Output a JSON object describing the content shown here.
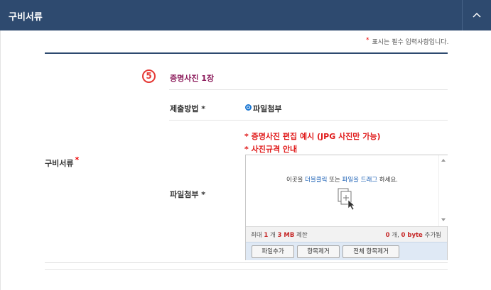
{
  "header": {
    "title": "구비서류"
  },
  "required_note": {
    "star": "*",
    "text": "표시는 필수 입력사항입니다."
  },
  "section": {
    "label": "구비서류",
    "star": "*"
  },
  "photo": {
    "number": "5",
    "title": "증명사진 1장"
  },
  "submit_method": {
    "label": "제출방법 *",
    "option": "파일첨부"
  },
  "links": {
    "example": "* 증명사진 편집 예시 (JPG 사진만 가능)",
    "guide": "* 사진규격 안내"
  },
  "attach": {
    "label": "파일첨부 *"
  },
  "uploader": {
    "drop_text_1": "이곳을 ",
    "drop_text_2": "더블클릭",
    "drop_text_3": " 또는 ",
    "drop_text_4": "파일을 드래그",
    "drop_text_5": " 하세요.",
    "limit_prefix": "최대 ",
    "limit_count": "1",
    "limit_mid": " 개 ",
    "limit_size": "3 MB",
    "limit_suffix": " 제한",
    "added_count": "0",
    "added_mid": " 개, ",
    "added_size": "0 byte",
    "added_suffix": " 추가됨",
    "icon": "file-add-icon"
  },
  "buttons": {
    "add": "파일추가",
    "remove": "항목제거",
    "remove_all": "전체 항목제거"
  },
  "colors": {
    "header_bg": "#2e4a6f",
    "accent_red": "#e01b1b",
    "title_purple": "#8b1a5a",
    "link_blue": "#1a5fb4"
  }
}
